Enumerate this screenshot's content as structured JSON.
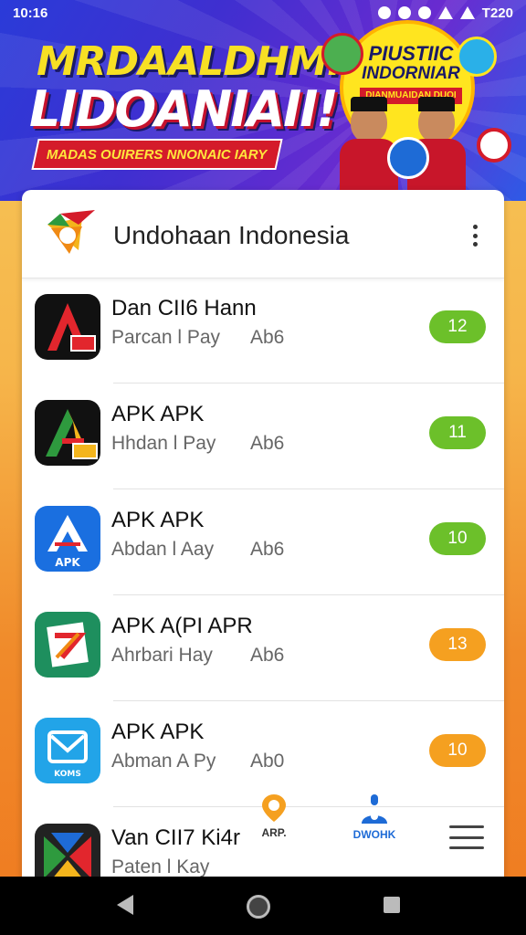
{
  "status_bar": {
    "time": "10:16",
    "right_text": "T220"
  },
  "banner": {
    "title_line1": "MRDAALDHMN",
    "title_line2": "LIDOANIAII!",
    "ribbon": "MADAS OUIRERS NNONAIC IARY",
    "badge_line1": "PIUSTIIC",
    "badge_line2": "INDORNIAR",
    "badge_line3": "DIANMUAIDAN DUOI"
  },
  "app": {
    "title": "Undohaan Indonesia"
  },
  "list": [
    {
      "name": "Dan CII6 Hann",
      "sub": "Parcan l Pay",
      "size": "Ab6",
      "count": "12",
      "pill_color": "#6cc02a"
    },
    {
      "name": "APK APK",
      "sub": "Hhdan l Pay",
      "size": "Ab6",
      "count": "11",
      "pill_color": "#6cc02a"
    },
    {
      "name": "APK APK",
      "sub": "Abdan l Aay",
      "size": "Ab6",
      "count": "10",
      "pill_color": "#6cc02a"
    },
    {
      "name": "APK A(PI APR",
      "sub": "Ahrbari Hay",
      "size": "Ab6",
      "count": "13",
      "pill_color": "#f5a020"
    },
    {
      "name": "APK APK",
      "sub": "Abman A Py",
      "size": "Ab0",
      "count": "10",
      "pill_color": "#f5a020"
    },
    {
      "name": "Van CII7 Ki4r",
      "sub": "Paten l Kay",
      "size": "",
      "count": "",
      "pill_color": ""
    }
  ],
  "icon_labels": {
    "apk_badge": "APK",
    "mail_badge": "KOMS"
  },
  "bottom_nav": {
    "item1_label": "ARP.",
    "item2_label": "DWOHK"
  },
  "colors": {
    "green": "#6cc02a",
    "orange": "#f5a020",
    "banner_blue": "#2a3bd8"
  },
  "icons": [
    "app-logo-icon",
    "kebab-menu-icon",
    "location-pin-icon",
    "info-icon",
    "hamburger-menu-icon",
    "back-icon",
    "home-icon",
    "recents-icon"
  ]
}
